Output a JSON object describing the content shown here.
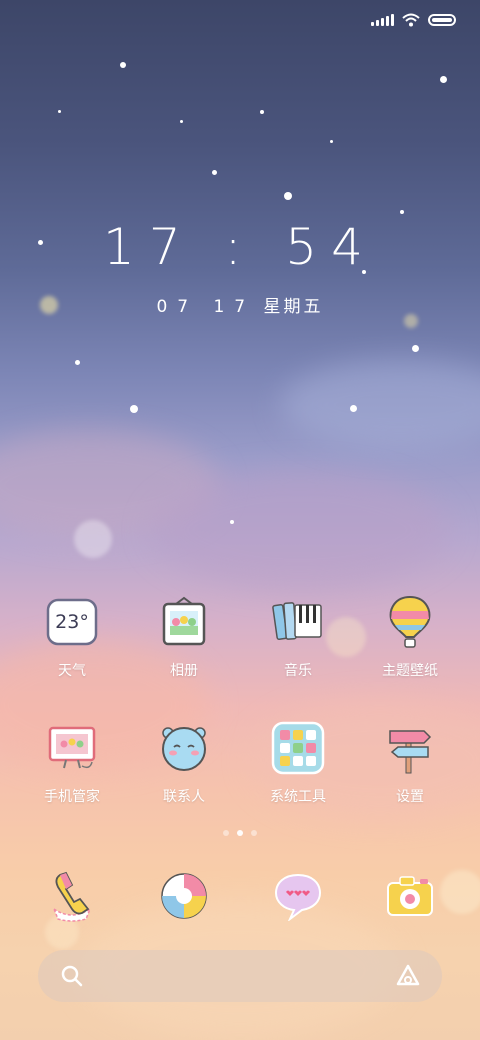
{
  "clock": {
    "time": "17 : 54"
  },
  "date": {
    "month_day": "07 17",
    "weekday": "星期五"
  },
  "apps_row1": [
    {
      "label": "天气",
      "icon": "weather-icon",
      "temp": "23°"
    },
    {
      "label": "相册",
      "icon": "gallery-icon"
    },
    {
      "label": "音乐",
      "icon": "music-icon"
    },
    {
      "label": "主题壁纸",
      "icon": "theme-balloon-icon"
    }
  ],
  "apps_row2": [
    {
      "label": "手机管家",
      "icon": "phone-manager-icon"
    },
    {
      "label": "联系人",
      "icon": "contacts-icon"
    },
    {
      "label": "系统工具",
      "icon": "system-tools-icon"
    },
    {
      "label": "设置",
      "icon": "settings-signpost-icon"
    }
  ],
  "dock": [
    {
      "icon": "phone-icon"
    },
    {
      "icon": "browser-icon"
    },
    {
      "icon": "messages-icon"
    },
    {
      "icon": "camera-icon"
    }
  ],
  "search": {
    "icon": "search-icon",
    "assistant_icon": "assistant-icon"
  },
  "colors": {
    "accent_pink": "#f08aa8",
    "accent_blue": "#7fc3e6",
    "accent_yellow": "#f7d65a"
  }
}
